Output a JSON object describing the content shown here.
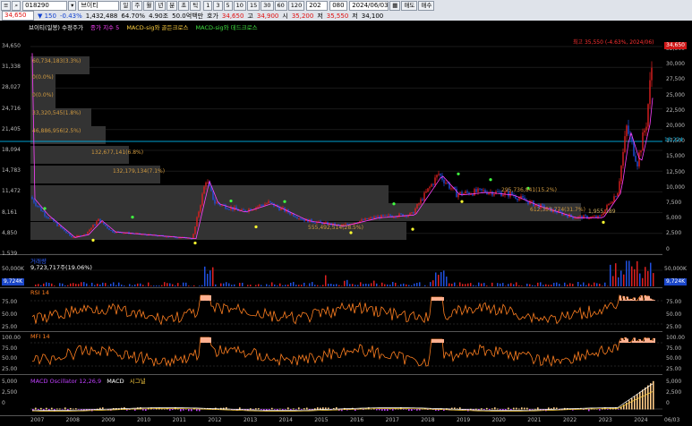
{
  "toolbar": {
    "code": "018290",
    "stock_name": "브이티",
    "change": "▼ 150",
    "change_pct": "-0.43%",
    "volume": "1,432,488",
    "volume_ratio": "64.70%",
    "turnover": "4.90조",
    "trade_value": "50.0억백만",
    "quote_label": "호가",
    "last_price": "34,650",
    "high_label": "고",
    "high_price": "34,900",
    "open_label": "시",
    "open_price": "35,200",
    "low_label": "저",
    "low_price": "35,550",
    "prev_label": "저",
    "prev_price": "34,100",
    "period_buttons": [
      "일",
      "주",
      "월",
      "년",
      "분",
      "초",
      "틱"
    ],
    "minute_buttons": [
      "1",
      "3",
      "5",
      "10",
      "15",
      "30",
      "60",
      "120"
    ],
    "count": "202",
    "count2": "080",
    "date": "2024/06/03",
    "save_label": "저장",
    "menu_labels": [
      "매도",
      "매수"
    ],
    "top_value": "34,650"
  },
  "price_panel": {
    "legend": [
      "브이티(일봉) 수정주가",
      "종가 지수 5",
      "MACD-sig와 골든크로스",
      "MACD-sig와 데드크로스"
    ],
    "left_labels": [
      "34,650",
      "31,338",
      "28,027",
      "24,716",
      "21,405",
      "18,094",
      "14,783",
      "11,472",
      "8,161",
      "4,850",
      "1,539"
    ],
    "right_labels": [
      "32,500",
      "30,000",
      "27,500",
      "25,000",
      "22,500",
      "20,000",
      "17,500",
      "15,000",
      "12,500",
      "10,000",
      "7,500",
      "5,000",
      "2,500",
      "0"
    ],
    "current_label": "34,650",
    "hline_label": "18,224",
    "max_annotation": "최고 35,550 (-4.63%, 2024/06)",
    "volume_profile": [
      "60,734,183(3.3%)",
      "0(0.0%)",
      "0(0.0%)",
      "33,320,545(1.8%)",
      "46,886,956(2.5%)",
      "132,677,141(6.8%)",
      "132,179,134(7.1%)",
      "295,736,841(15.2%)",
      "612,353,774(31.7%)",
      "555,492,514(28.5%)"
    ],
    "small_label": "1,955,189"
  },
  "volume_panel": {
    "legend": "거래량",
    "value": "9,723,717주(19.06%)",
    "left_labels": [
      "50,000K",
      "0"
    ],
    "right_labels": [
      "50,000K",
      "0"
    ],
    "badge": "9,724K"
  },
  "rsi_panel": {
    "legend": "RSI 14",
    "left_labels": [
      "75.00",
      "50.00",
      "25.00"
    ],
    "right_labels": [
      "75.00",
      "50.00",
      "25.00"
    ]
  },
  "mfi_panel": {
    "legend": "MFI 14",
    "left_labels": [
      "100.00",
      "75.00",
      "50.00",
      "25.00"
    ],
    "right_labels": [
      "100.00",
      "75.00",
      "50.00",
      "25.00"
    ]
  },
  "macd_panel": {
    "legend": [
      "MACD Oscillator 12,26,9",
      "MACD",
      "시그널"
    ],
    "left_labels": [
      "5,000",
      "2,500",
      "0"
    ],
    "right_labels": [
      "5,000",
      "2,500",
      "0"
    ]
  },
  "x_labels": [
    "2007",
    "2008",
    "2009",
    "2010",
    "2011",
    "2012",
    "2013",
    "2014",
    "2015",
    "2016",
    "2017",
    "2018",
    "2019",
    "2020",
    "2021",
    "2022",
    "2023",
    "2024",
    "06/03"
  ],
  "colors": {
    "up": "#e02020",
    "down": "#2050e0",
    "ma": "#ff40ff",
    "hline": "#00a0d0",
    "orange": "#ff7f20",
    "profile": "#3a3a3a"
  }
}
